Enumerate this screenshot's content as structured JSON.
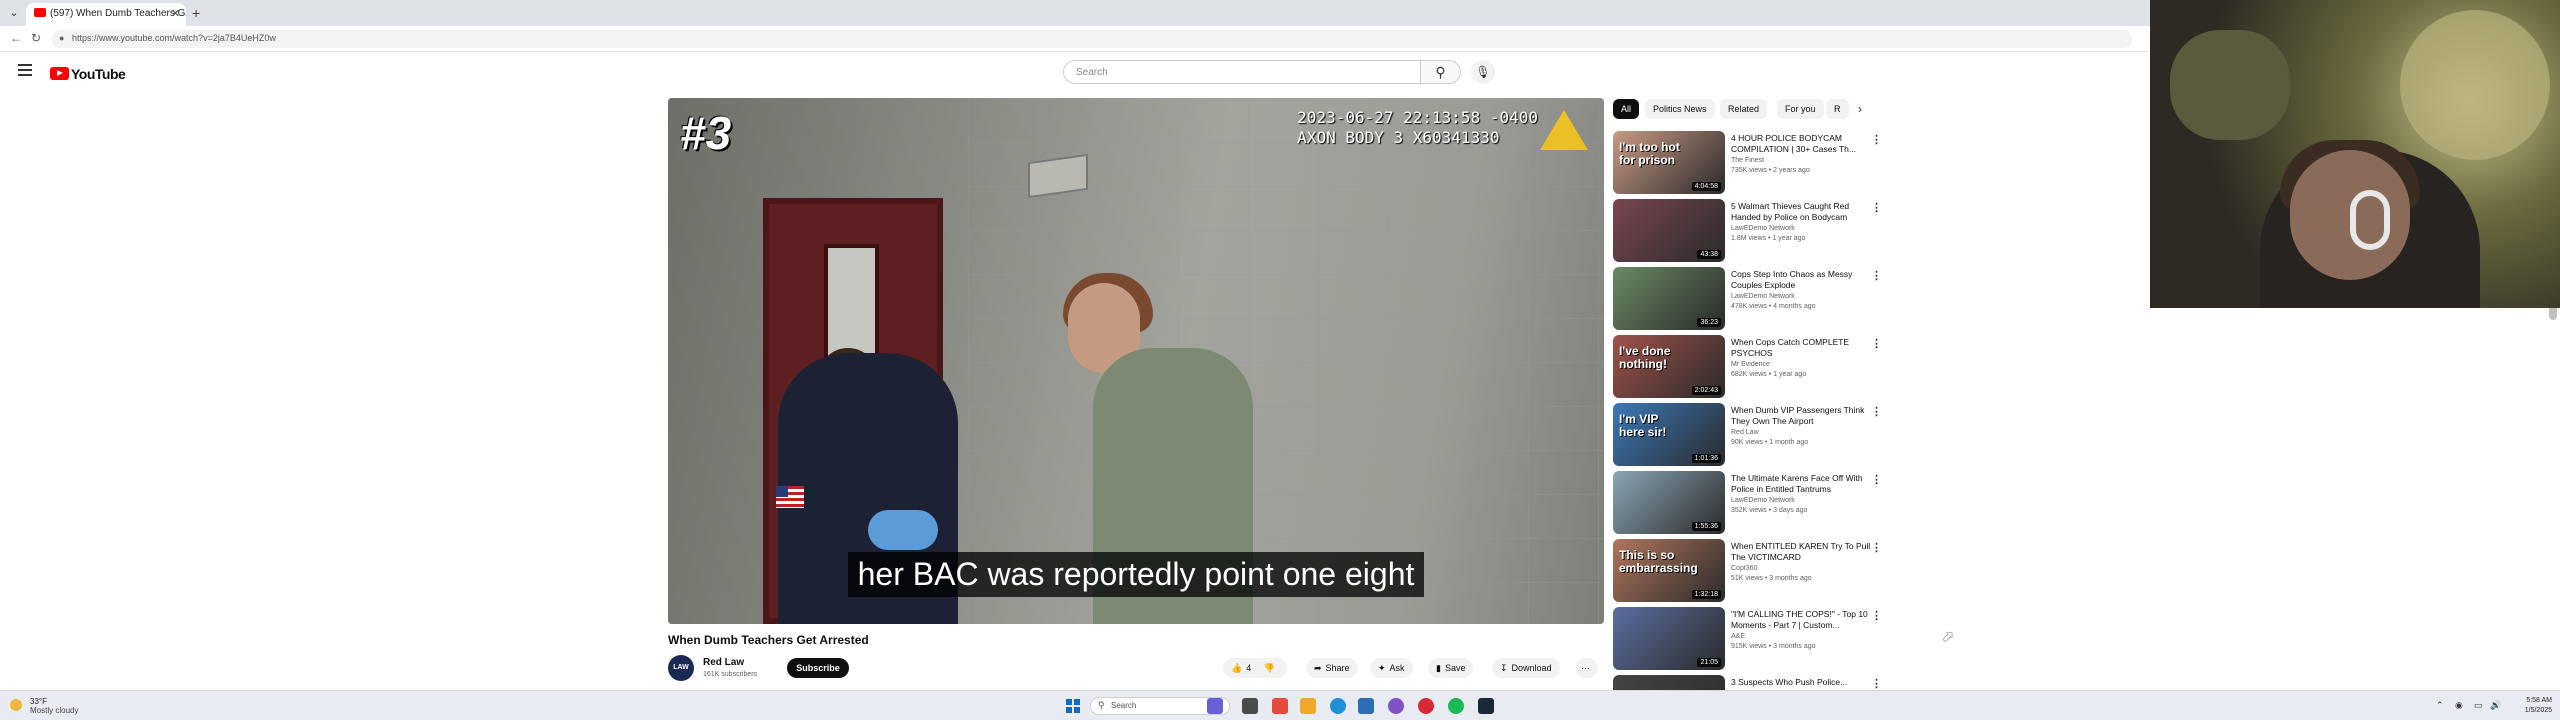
{
  "browser": {
    "tab_title": "(597) When Dumb Teachers G",
    "url": "https://www.youtube.com/watch?v=2ja7B4UeHZ0w",
    "icons": [
      "tab-list-icon",
      "youtube-favicon-icon",
      "close-icon",
      "new-tab-icon",
      "back-icon",
      "reload-icon",
      "lock-icon"
    ]
  },
  "header": {
    "logo_text": "YouTube",
    "search_placeholder": "Search",
    "icons": [
      "menu-icon",
      "search-icon",
      "mic-icon"
    ]
  },
  "player": {
    "overlay_number": "#3",
    "timestamp_line1": "2023-06-27 22:13:58 -0400",
    "timestamp_line2": "AXON BODY 3 X60341330",
    "caption": "her BAC was reportedly point one eight"
  },
  "video": {
    "title": "When Dumb Teachers Get Arrested",
    "channel": "Red Law",
    "channel_avatar_text": "LAW",
    "subscribers": "161K subscribers",
    "subscribe_label": "Subscribe",
    "like_count": "4",
    "share_label": "Share",
    "ask_label": "Ask",
    "save_label": "Save",
    "download_label": "Download",
    "more_label": "⋯"
  },
  "chips": [
    "All",
    "Politics News",
    "Related",
    "For you",
    "R"
  ],
  "recommendations": [
    {
      "title": "4 HOUR POLICE BODYCAM COMPILATION | 30+ Cases Th...",
      "channel": "The Finest",
      "meta": "735K views • 2 years ago",
      "duration": "4:04:58",
      "overlay": "I'm too hot\nfor prison",
      "thumb_color": "#c89a84"
    },
    {
      "title": "5 Walmart Thieves Caught Red Handed by Police on Bodycam",
      "channel": "LawEDemo Network",
      "meta": "1.8M views • 1 year ago",
      "duration": "43:38",
      "overlay": "",
      "thumb_color": "#7a4650"
    },
    {
      "title": "Cops Step Into Chaos as Messy Couples Explode",
      "channel": "LawEDemo Network",
      "meta": "478K views • 4 months ago",
      "duration": "36:23",
      "overlay": "",
      "thumb_color": "#6a8a64"
    },
    {
      "title": "When Cops Catch COMPLETE PSYCHOS",
      "channel": "Mr Evidence",
      "meta": "682K views • 1 year ago",
      "duration": "2:02:43",
      "overlay": "I've done\nnothing!",
      "thumb_color": "#a0524a"
    },
    {
      "title": "When Dumb VIP Passengers Think They Own The Airport",
      "channel": "Red Law",
      "meta": "90K views • 1 month ago",
      "duration": "1:01:36",
      "overlay": "I'm VIP\nhere sir!",
      "thumb_color": "#3b78b8"
    },
    {
      "title": "The Ultimate Karens Face Off With Police in Entitled Tantrums",
      "channel": "LawEDemo Network",
      "meta": "352K views • 3 days ago",
      "duration": "1:55:36",
      "overlay": "",
      "thumb_color": "#8aa6b6"
    },
    {
      "title": "When ENTITLED KAREN Try To Pull The VICTIMCARD",
      "channel": "Copt360",
      "meta": "51K views • 3 months ago",
      "duration": "1:32:18",
      "overlay": "This is so\nembarrassing",
      "thumb_color": "#b0765c"
    },
    {
      "title": "\"I'M CALLING THE COPS!\" - Top 10 Moments - Part 7 | Custom...",
      "channel": "A&E",
      "meta": "915K views • 3 months ago",
      "duration": "21:05",
      "overlay": "",
      "thumb_color": "#5a6ea0"
    },
    {
      "title": "3 Suspects Who Push Police...",
      "channel": "",
      "meta": "",
      "duration": "",
      "overlay": "",
      "thumb_color": "#444444"
    }
  ],
  "taskbar": {
    "temperature": "33°F",
    "weather": "Mostly cloudy",
    "search_label": "Search",
    "time": "5:58 AM",
    "date": "1/5/2025"
  }
}
